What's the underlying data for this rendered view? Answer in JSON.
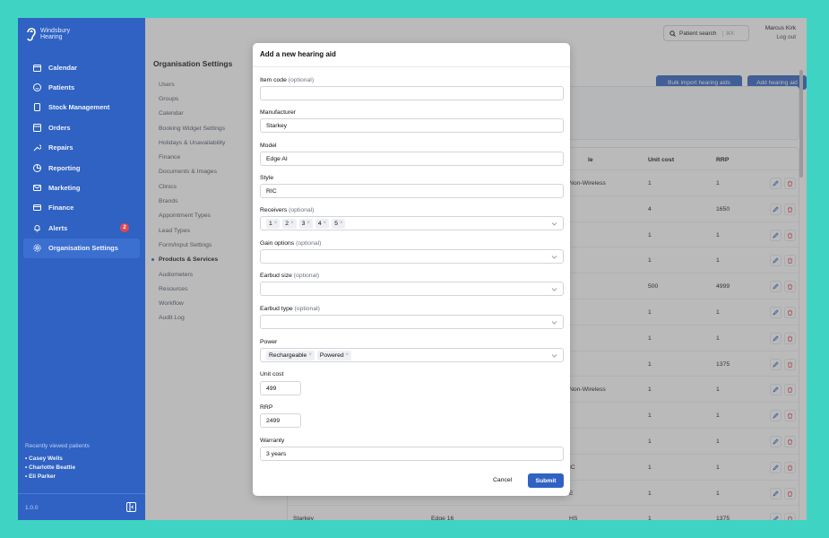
{
  "app": {
    "logo_line1": "Windsbury",
    "logo_line2": "Hearing",
    "version": "1.0.0"
  },
  "sidebar": {
    "items": [
      {
        "label": "Calendar",
        "icon": "calendar-icon"
      },
      {
        "label": "Patients",
        "icon": "smile-icon"
      },
      {
        "label": "Stock Management",
        "icon": "clipboard-icon"
      },
      {
        "label": "Orders",
        "icon": "box-icon"
      },
      {
        "label": "Repairs",
        "icon": "wrench-icon"
      },
      {
        "label": "Reporting",
        "icon": "pie-chart-icon"
      },
      {
        "label": "Marketing",
        "icon": "mail-icon"
      },
      {
        "label": "Finance",
        "icon": "credit-card-icon"
      },
      {
        "label": "Alerts",
        "icon": "bell-icon",
        "badge": "2"
      },
      {
        "label": "Organisation Settings",
        "icon": "gear-icon",
        "active": true
      }
    ],
    "recent_title": "Recently viewed patients",
    "recent": [
      "• Casey Wells",
      "• Charlotte Beattie",
      "• Eli Parker"
    ]
  },
  "topbar": {
    "search_label": "Patient search",
    "search_shortcut": "⌘K",
    "user_name": "Marcus Kirk",
    "logout": "Log out"
  },
  "settings": {
    "title": "Organisation Settings",
    "items": [
      "Users",
      "Groups",
      "Calendar",
      "Booking Widget Settings",
      "Holidays & Unavailability",
      "Finance",
      "Documents & Images",
      "Clinics",
      "Brands",
      "Appointment Types",
      "Lead Types",
      "Form/Input Settings",
      "Products & Services",
      "Audiometers",
      "Resources",
      "Workflow",
      "Audit Log"
    ],
    "active": "Products & Services"
  },
  "main": {
    "bulk_import": "Bulk import hearing aids",
    "add_hearing_aid": "Add hearing aid",
    "columns": {
      "style": "le",
      "unit_cost": "Unit cost",
      "rrp": "RRP"
    },
    "rows": [
      {
        "manufacturer": "",
        "model": "",
        "style": "Non-Wireless",
        "unit_cost": "1",
        "rrp": "1"
      },
      {
        "manufacturer": "",
        "model": "",
        "style": "",
        "unit_cost": "4",
        "rrp": "1650"
      },
      {
        "manufacturer": "",
        "model": "",
        "style": "",
        "unit_cost": "1",
        "rrp": "1"
      },
      {
        "manufacturer": "",
        "model": "",
        "style": "",
        "unit_cost": "1",
        "rrp": "1"
      },
      {
        "manufacturer": "",
        "model": "",
        "style": "",
        "unit_cost": "500",
        "rrp": "4999"
      },
      {
        "manufacturer": "",
        "model": "",
        "style": "",
        "unit_cost": "1",
        "rrp": "1"
      },
      {
        "manufacturer": "",
        "model": "",
        "style": "",
        "unit_cost": "1",
        "rrp": "1"
      },
      {
        "manufacturer": "",
        "model": "",
        "style": "",
        "unit_cost": "1",
        "rrp": "1375"
      },
      {
        "manufacturer": "",
        "model": "",
        "style": "Non-Wireless",
        "unit_cost": "1",
        "rrp": "1"
      },
      {
        "manufacturer": "",
        "model": "",
        "style": "",
        "unit_cost": "1",
        "rrp": "1"
      },
      {
        "manufacturer": "",
        "model": "",
        "style": "",
        "unit_cost": "1",
        "rrp": "1"
      },
      {
        "manufacturer": "",
        "model": "",
        "style": "IC",
        "unit_cost": "1",
        "rrp": "1"
      },
      {
        "manufacturer": "",
        "model": "",
        "style": "E",
        "unit_cost": "1",
        "rrp": "1"
      },
      {
        "manufacturer": "Starkey",
        "model": "Edge 16",
        "style": "HS",
        "unit_cost": "1",
        "rrp": "1375"
      }
    ]
  },
  "modal": {
    "title": "Add a new hearing aid",
    "item_code_label": "Item code",
    "optional": "(optional)",
    "item_code_value": "",
    "manufacturer_label": "Manufacturer",
    "manufacturer_value": "Starkey",
    "model_label": "Model",
    "model_value": "Edge AI",
    "style_label": "Style",
    "style_value": "RIC",
    "receivers_label": "Receivers",
    "receivers": [
      "1",
      "2",
      "3",
      "4",
      "5"
    ],
    "gain_label": "Gain options",
    "earbud_size_label": "Earbud size",
    "earbud_type_label": "Earbud type",
    "power_label": "Power",
    "power": [
      "Rechargeable",
      "Powered"
    ],
    "unit_cost_label": "Unit cost",
    "unit_cost_value": "499",
    "rrp_label": "RRP",
    "rrp_value": "2499",
    "warranty_label": "Warranty",
    "warranty_value": "3 years",
    "cancel": "Cancel",
    "submit": "Submit",
    "tag_remove": "×"
  }
}
